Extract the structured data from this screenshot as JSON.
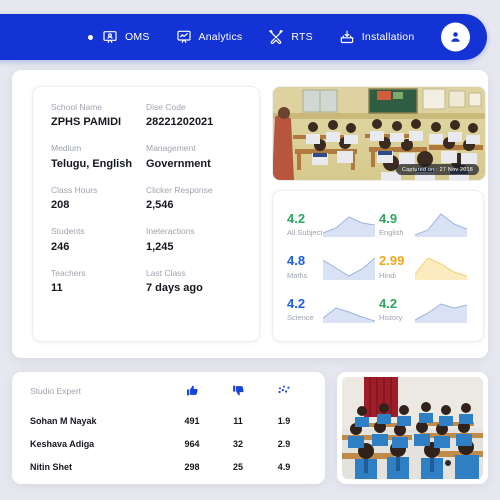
{
  "nav": {
    "items": [
      {
        "label": "OMS",
        "icon": "presenter-user-icon",
        "active": true
      },
      {
        "label": "Analytics",
        "icon": "chart-board-icon",
        "active": false
      },
      {
        "label": "RTS",
        "icon": "tools-icon",
        "active": false
      },
      {
        "label": "Installation",
        "icon": "install-tray-icon",
        "active": false
      }
    ],
    "avatar_icon": "user-avatar-icon",
    "bar_color": "#1433d4"
  },
  "school_info": {
    "fields": [
      {
        "label": "School Name",
        "value": "ZPHS PAMIDI"
      },
      {
        "label": "Dise Code",
        "value": "28221202021"
      },
      {
        "label": "Medium",
        "value": "Telugu, English"
      },
      {
        "label": "Management",
        "value": "Government"
      },
      {
        "label": "Class Hours",
        "value": "208"
      },
      {
        "label": "Clicker Response",
        "value": "2,546"
      },
      {
        "label": "Students",
        "value": "246"
      },
      {
        "label": "Ineteractions",
        "value": "1,245"
      },
      {
        "label": "Teachers",
        "value": "11"
      },
      {
        "label": "Last Class",
        "value": "7 days ago"
      }
    ]
  },
  "classroom_photo": {
    "caption": "Captured on : 27 Nov 2018",
    "alt": "classroom-photo-students-at-desks"
  },
  "classroom_photo_2": {
    "alt": "classroom-photo-students-blue-uniform"
  },
  "subjects": [
    {
      "name": "All Subject",
      "score": "4.2",
      "color": "#2aa85f"
    },
    {
      "name": "English",
      "score": "4.9",
      "color": "#2aa85f"
    },
    {
      "name": "Maths",
      "score": "4.8",
      "color": "#1a5fe0"
    },
    {
      "name": "Hindi",
      "score": "2.99",
      "color": "#f0a818"
    },
    {
      "name": "Science",
      "score": "4.2",
      "color": "#1a5fe0"
    },
    {
      "name": "History",
      "score": "4.2",
      "color": "#2aa85f"
    }
  ],
  "studio_expert": {
    "title": "Studio Expert",
    "columns": [
      {
        "icon": "thumbs-up-icon"
      },
      {
        "icon": "thumbs-down-icon"
      },
      {
        "icon": "scatter-trend-icon"
      }
    ],
    "rows": [
      {
        "name": "Sohan M Nayak",
        "likes": "491",
        "dislikes": "11",
        "rating": "1.9"
      },
      {
        "name": "Keshava Adiga",
        "likes": "964",
        "dislikes": "32",
        "rating": "2.9"
      },
      {
        "name": "Nitin Shet",
        "likes": "298",
        "dislikes": "25",
        "rating": "4.9"
      }
    ]
  },
  "chart_data": {
    "type": "line",
    "title": "Subject score sparklines",
    "series": [
      {
        "name": "All Subject",
        "score": 4.2,
        "values": [
          0.15,
          0.35,
          0.75,
          0.55,
          0.45
        ]
      },
      {
        "name": "English",
        "score": 4.9,
        "values": [
          0.05,
          0.3,
          0.95,
          0.5,
          0.25
        ]
      },
      {
        "name": "Maths",
        "score": 4.8,
        "values": [
          0.8,
          0.45,
          0.15,
          0.4,
          0.85
        ]
      },
      {
        "name": "Hindi",
        "score": 2.99,
        "values": [
          0.25,
          0.85,
          0.6,
          0.3,
          0.15
        ]
      },
      {
        "name": "Science",
        "score": 4.2,
        "values": [
          0.2,
          0.6,
          0.45,
          0.25,
          0.1
        ]
      },
      {
        "name": "History",
        "score": 4.2,
        "values": [
          0.1,
          0.4,
          0.8,
          0.6,
          0.75
        ]
      }
    ],
    "ylim": [
      0,
      1
    ],
    "grid": false,
    "legend": "none"
  }
}
